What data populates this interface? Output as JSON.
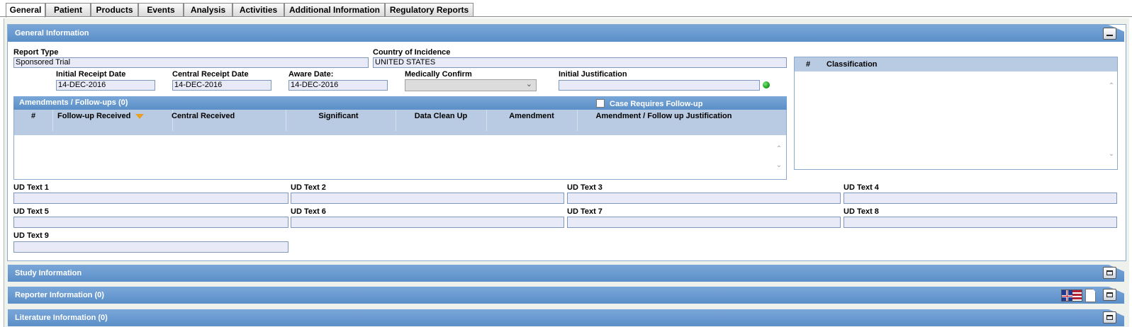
{
  "tabs": [
    "General",
    "Patient",
    "Products",
    "Events",
    "Analysis",
    "Activities",
    "Additional Information",
    "Regulatory Reports"
  ],
  "general_section": {
    "title": "General Information",
    "report_type_label": "Report Type",
    "report_type_value": "Sponsored Trial",
    "country_label": "Country of Incidence",
    "country_value": "UNITED STATES",
    "initial_receipt_label": "Initial Receipt Date",
    "initial_receipt_value": "14-DEC-2016",
    "central_receipt_label": "Central Receipt Date",
    "central_receipt_value": "14-DEC-2016",
    "aware_date_label": "Aware Date:",
    "aware_date_value": "14-DEC-2016",
    "medically_confirm_label": "Medically Confirm",
    "medically_confirm_value": "",
    "initial_justification_label": "Initial Justification",
    "initial_justification_value": "",
    "status_dot_color": "#1aa31a"
  },
  "amendments": {
    "title": "Amendments / Follow-ups (0)",
    "case_requires_followup_label": "Case Requires Follow-up",
    "case_requires_followup_checked": false,
    "columns": [
      "#",
      "Follow-up Received",
      "Central Received",
      "Significant",
      "Data Clean Up",
      "Amendment",
      "Amendment / Follow up Justification"
    ],
    "rows": []
  },
  "classification": {
    "columns": [
      "#",
      "Classification"
    ],
    "rows": []
  },
  "ud_text": [
    {
      "label": "UD Text 1",
      "value": ""
    },
    {
      "label": "UD Text 2",
      "value": ""
    },
    {
      "label": "UD Text 3",
      "value": ""
    },
    {
      "label": "UD Text 4",
      "value": ""
    },
    {
      "label": "UD Text 5",
      "value": ""
    },
    {
      "label": "UD Text 6",
      "value": ""
    },
    {
      "label": "UD Text 7",
      "value": ""
    },
    {
      "label": "UD Text 8",
      "value": ""
    },
    {
      "label": "UD Text 9",
      "value": ""
    }
  ],
  "collapsed_sections": {
    "study": "Study Information",
    "reporter": "Reporter Information (0)",
    "literature": "Literature Information (0)"
  },
  "icons": {
    "collapse": "minimize-icon",
    "expand": "maximize-icon",
    "flag": "uk-us-flag-icon",
    "document": "document-icon",
    "sort": "sort-desc-icon"
  },
  "colors": {
    "header_blue": "#5b8fc8",
    "grid_header": "#b9cbe3",
    "field_bg": "#e8ebf7",
    "sort_arrow": "#e8a020"
  }
}
